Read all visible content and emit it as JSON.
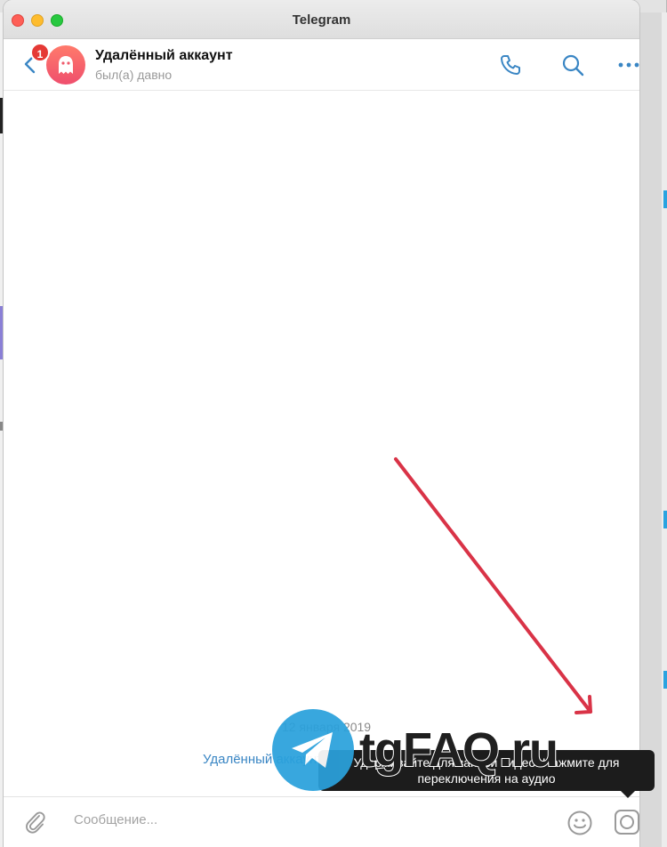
{
  "window": {
    "title": "Telegram"
  },
  "header": {
    "unread_badge": "1",
    "chat_name": "Удалённый аккаунт",
    "chat_status": "был(а) давно",
    "icons": [
      "back-arrow-icon",
      "ghost-avatar-icon",
      "phone-icon",
      "search-icon",
      "more-dots-icon"
    ]
  },
  "chat": {
    "date_label": "12 января 2019",
    "service_message": "Удалённый аккаунт"
  },
  "composer": {
    "placeholder": "Сообщение...",
    "icons": [
      "paperclip-icon",
      "emoji-icon",
      "video-message-icon"
    ]
  },
  "tooltip": {
    "line1": "Удерживайте для записи видео. Нажмите для",
    "line2": "переключения на аудио"
  },
  "watermark": {
    "text": "tgFAQ.ru"
  },
  "colors": {
    "accent": "#3a86c4",
    "badge": "#e53935",
    "avatar_top": "#ff7a6b",
    "avatar_bottom": "#ef4f6d",
    "annotation_arrow": "#d93347",
    "watermark_circle": "#2aa1dc"
  }
}
